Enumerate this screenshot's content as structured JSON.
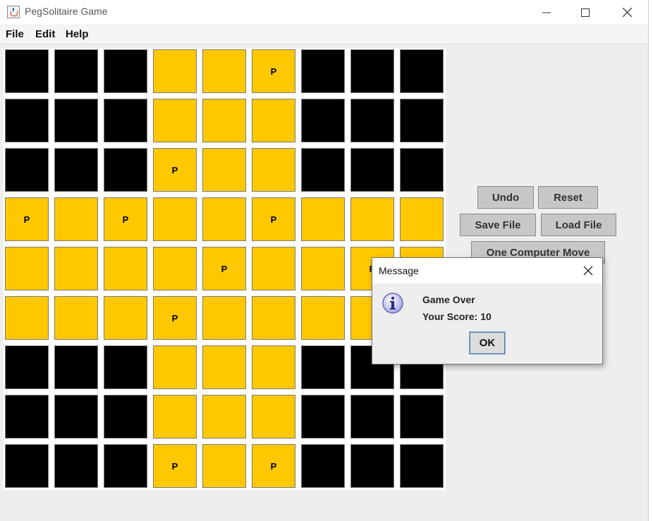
{
  "window": {
    "title": "PegSolitaire Game"
  },
  "menu": [
    "File",
    "Edit",
    "Help"
  ],
  "board": {
    "rows": [
      [
        "B",
        "B",
        "B",
        "Y",
        "Y",
        "YP",
        "B",
        "B",
        "B"
      ],
      [
        "B",
        "B",
        "B",
        "Y",
        "Y",
        "Y",
        "B",
        "B",
        "B"
      ],
      [
        "B",
        "B",
        "B",
        "YP",
        "Y",
        "Y",
        "B",
        "B",
        "B"
      ],
      [
        "YP",
        "Y",
        "YP",
        "Y",
        "Y",
        "YP",
        "Y",
        "Y",
        "Y"
      ],
      [
        "Y",
        "Y",
        "Y",
        "Y",
        "YP",
        "Y",
        "Y",
        "YP",
        "Y"
      ],
      [
        "Y",
        "Y",
        "Y",
        "YP",
        "Y",
        "Y",
        "Y",
        "Y",
        "Y"
      ],
      [
        "B",
        "B",
        "B",
        "Y",
        "Y",
        "Y",
        "B",
        "B",
        "B"
      ],
      [
        "B",
        "B",
        "B",
        "Y",
        "Y",
        "Y",
        "B",
        "B",
        "B"
      ],
      [
        "B",
        "B",
        "B",
        "YP",
        "Y",
        "YP",
        "B",
        "B",
        "B"
      ]
    ],
    "peg_label": "P",
    "colors": {
      "black": "#000000",
      "yellow": "#ffc800"
    }
  },
  "buttons": {
    "undo": "Undo",
    "reset": "Reset",
    "save_file": "Save File",
    "load_file": "Load File",
    "one_computer_move": "One Computer Move"
  },
  "dialog": {
    "title": "Message",
    "line1": "Game Over",
    "line2": "Your Score: 10",
    "ok": "OK"
  }
}
